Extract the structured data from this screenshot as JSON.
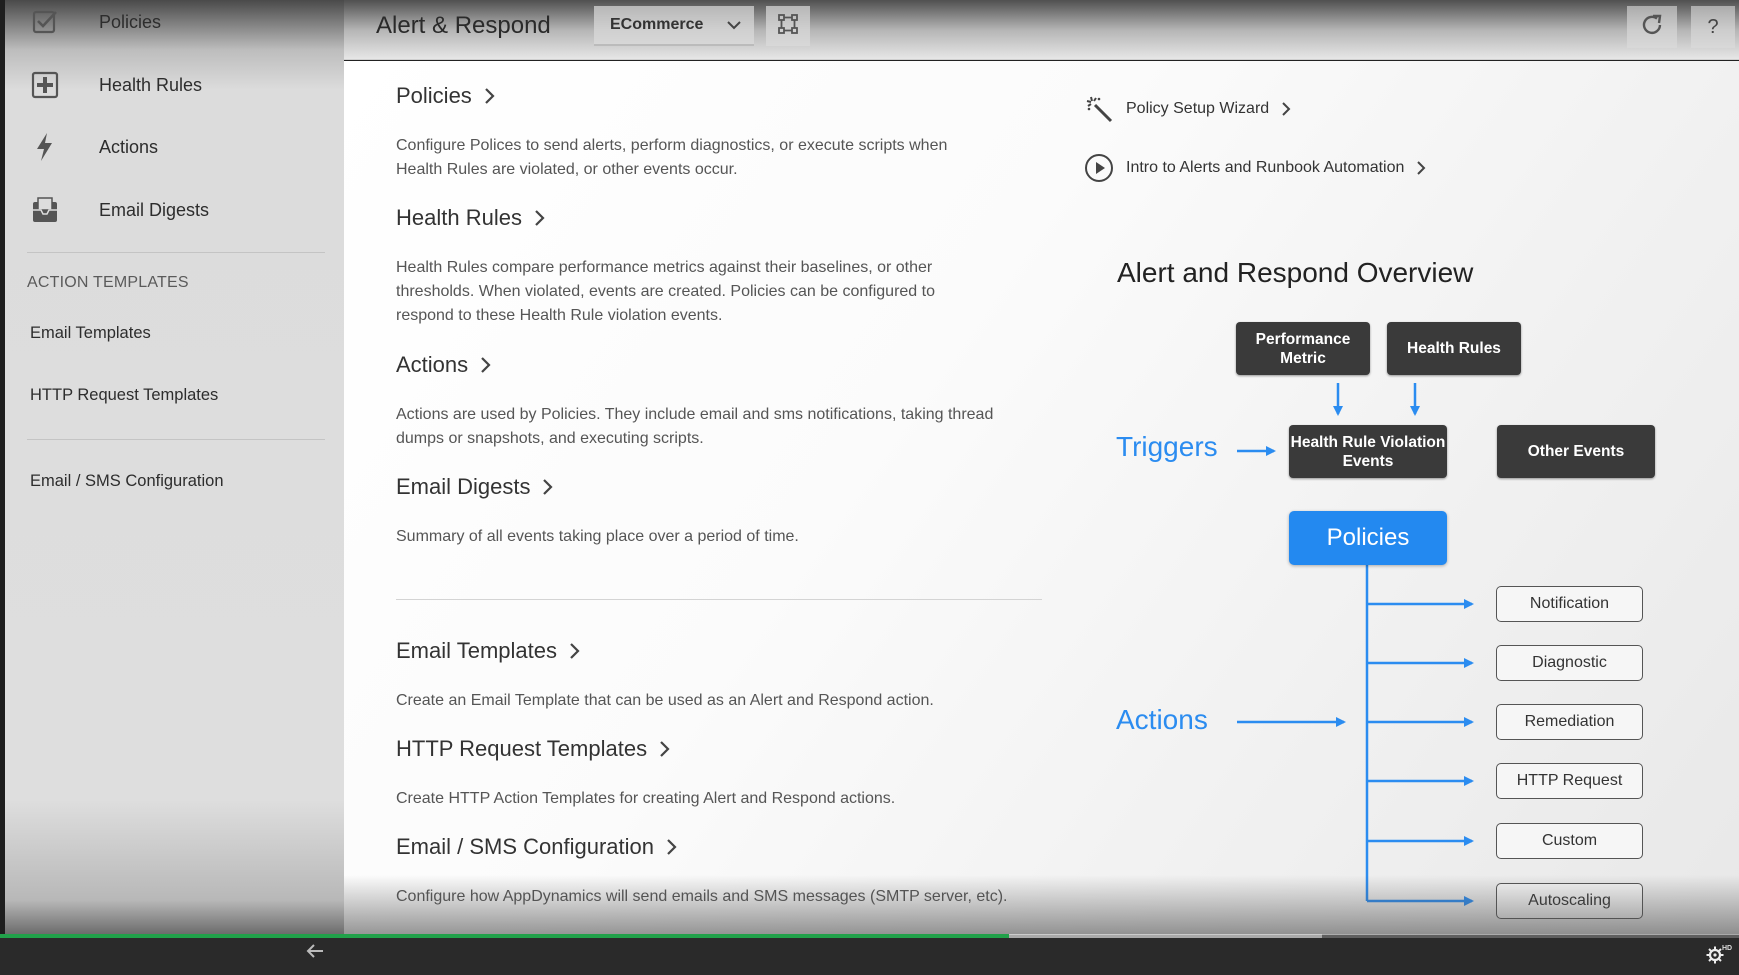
{
  "colors": {
    "accent_blue": "#2389f0",
    "dark_box": "#3a3a3a",
    "progress_green": "#21a14a"
  },
  "sidebar": {
    "items": [
      {
        "label": "Policies",
        "icon": "checkbox-icon"
      },
      {
        "label": "Health Rules",
        "icon": "plus-box-icon"
      },
      {
        "label": "Actions",
        "icon": "lightning-icon"
      },
      {
        "label": "Email Digests",
        "icon": "mail-tray-icon"
      }
    ],
    "section_title": "ACTION TEMPLATES",
    "template_links": [
      "Email Templates",
      "HTTP Request Templates"
    ],
    "config_link": "Email / SMS Configuration"
  },
  "header": {
    "title": "Alert & Respond",
    "application": "ECommerce",
    "help_label": "?"
  },
  "main": {
    "sections": [
      {
        "title": "Policies",
        "description": "Configure Polices to send alerts, perform diagnostics, or execute scripts when Health Rules are violated, or other events occur."
      },
      {
        "title": "Health Rules",
        "description": "Health Rules compare performance metrics against their baselines, or other thresholds. When violated, events are created. Policies can be configured to respond to these Health Rule violation events."
      },
      {
        "title": "Actions",
        "description": "Actions are used by Policies. They include email and sms notifications, taking thread dumps or snapshots, and executing scripts."
      },
      {
        "title": "Email Digests",
        "description": "Summary of all events taking place over a period of time."
      },
      {
        "title": "Email Templates",
        "description": "Create an Email Template that can be used as an Alert and Respond action."
      },
      {
        "title": "HTTP Request Templates",
        "description": "Create HTTP Action Templates for creating Alert and Respond actions."
      },
      {
        "title": "Email / SMS Configuration",
        "description": "Configure how AppDynamics will send emails and SMS messages (SMTP server, etc)."
      }
    ],
    "quick_links": [
      {
        "label": "Policy Setup Wizard",
        "icon": "magic-wand-icon"
      },
      {
        "label": "Intro to Alerts and Runbook Automation",
        "icon": "play-circle-icon"
      }
    ]
  },
  "diagram": {
    "title": "Alert and Respond Overview",
    "performance_metric": "Performance Metric",
    "health_rules": "Health Rules",
    "triggers_label": "Triggers",
    "violation_events": "Health Rule Violation Events",
    "other_events": "Other Events",
    "policies": "Policies",
    "actions_label": "Actions",
    "action_types": [
      "Notification",
      "Diagnostic",
      "Remediation",
      "HTTP Request",
      "Custom",
      "Autoscaling"
    ]
  },
  "video": {
    "played_fraction": 0.58,
    "buffered_fraction": 0.76,
    "hd_label": "HD"
  }
}
